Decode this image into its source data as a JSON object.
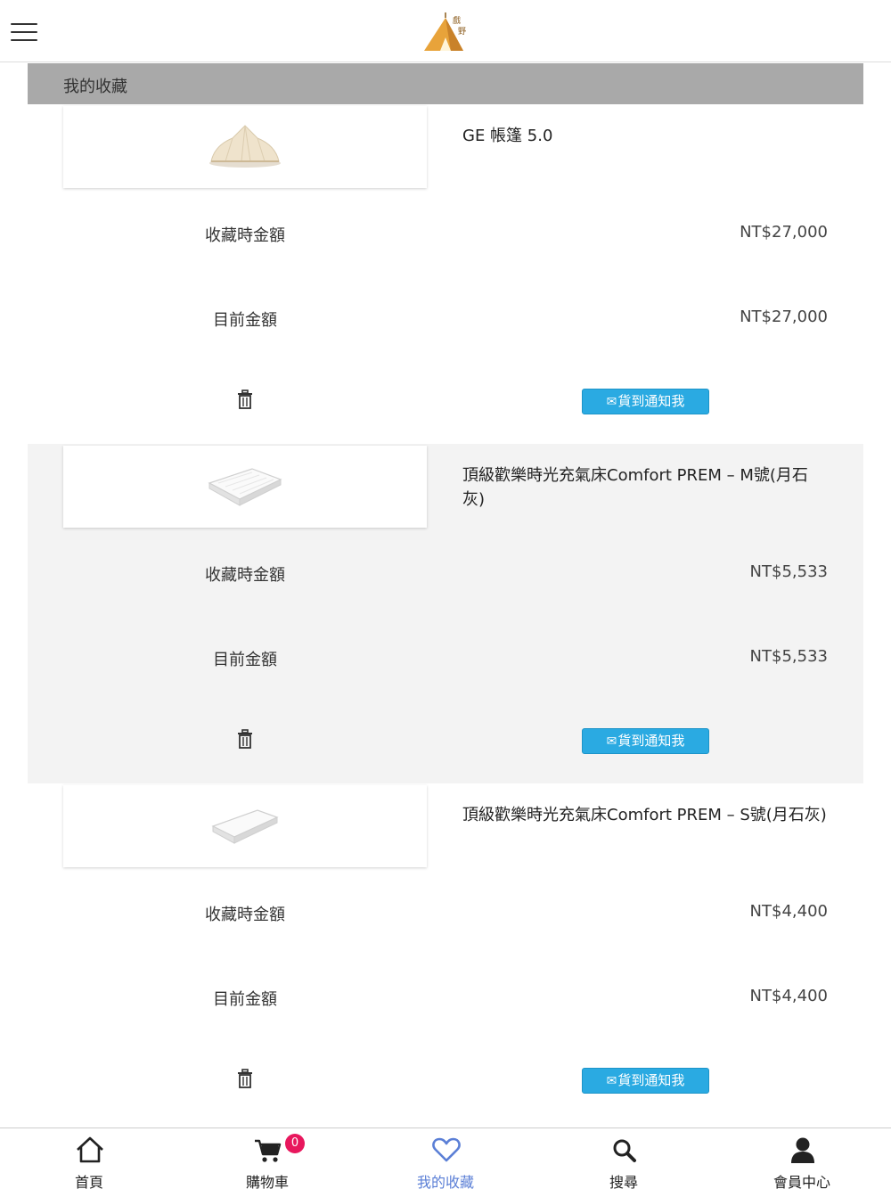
{
  "header": {
    "menu_icon": "hamburger-menu-icon",
    "logo_icon": "tent-logo-icon"
  },
  "section": {
    "title": "我的收藏"
  },
  "labels": {
    "saved_price": "收藏時金額",
    "current_price": "目前金額",
    "notify_button": "貨到通知我",
    "envelope_icon": "✉"
  },
  "items": [
    {
      "name": "GE 帳篷 5.0",
      "saved_price": "NT$27,000",
      "current_price": "NT$27,000",
      "thumb": "bell-tent"
    },
    {
      "name": "頂級歡樂時光充氣床Comfort PREM – M號(月石灰)",
      "saved_price": "NT$5,533",
      "current_price": "NT$5,533",
      "thumb": "air-mattress-m"
    },
    {
      "name": "頂級歡樂時光充氣床Comfort PREM – S號(月石灰)",
      "saved_price": "NT$4,400",
      "current_price": "NT$4,400",
      "thumb": "air-mattress-s"
    }
  ],
  "bottom_nav": {
    "home": "首頁",
    "cart": "購物車",
    "cart_count": "0",
    "favorites": "我的收藏",
    "search": "搜尋",
    "member": "會員中心"
  },
  "colors": {
    "accent": "#5b7fd6",
    "notify_button": "#2aaae2",
    "badge": "#e8175d",
    "section_header": "#a9a9a9"
  }
}
